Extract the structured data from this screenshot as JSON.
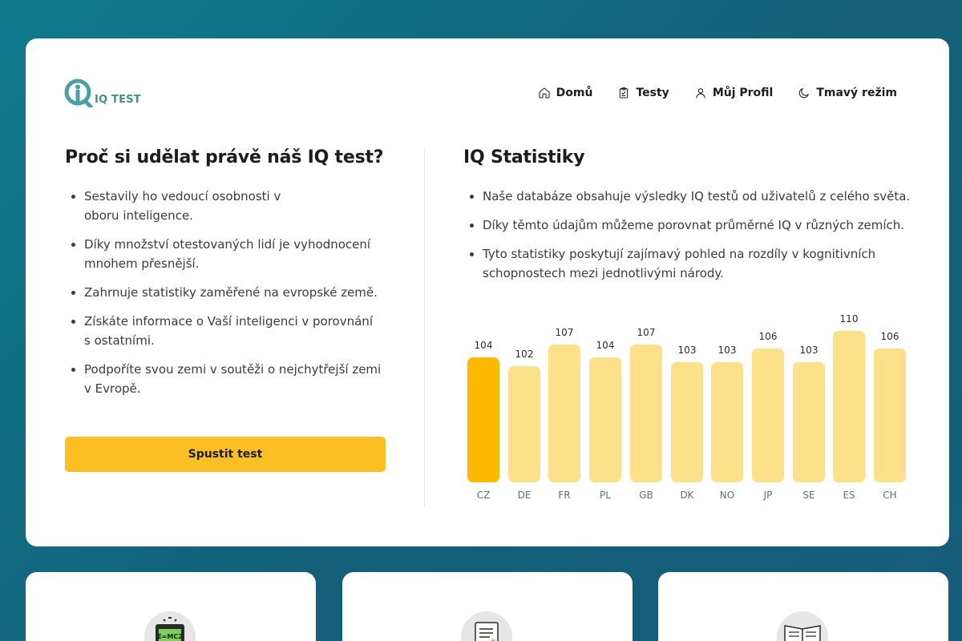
{
  "logo": {
    "text": "IQ TEST"
  },
  "nav": [
    {
      "label": "Domů",
      "icon": "home-icon"
    },
    {
      "label": "Testy",
      "icon": "clipboard-icon"
    },
    {
      "label": "Můj Profil",
      "icon": "user-icon"
    },
    {
      "label": "Tmavý režim",
      "icon": "moon-icon"
    }
  ],
  "left": {
    "title": "Proč si udělat právě náš IQ test?",
    "bullets": [
      "Sestavily ho vedoucí osobnosti v oboru inteligence.",
      "Díky množství otestovaných lidí je vyhodnocení mnohem přesnější.",
      "Zahrnuje statistiky zaměřené na evropské země.",
      "Získáte informace o Vaší inteligenci v porovnání s ostatními.",
      "Podpoříte svou zemi v soutěži o nejchytřejší zemi v Evropě."
    ],
    "button_label": "Spustit test"
  },
  "right": {
    "title": "IQ Statistiky",
    "bullets": [
      "Naše databáze obsahuje výsledky IQ testů od uživatelů z celého světa.",
      "Díky těmto údajům můžeme porovnat průměrné IQ v různých zemích.",
      "Tyto statistiky poskytují zajímavý pohled na rozdíly v kognitivních schopnostech mezi jednotlivými národy."
    ]
  },
  "chart_data": {
    "type": "bar",
    "categories": [
      "CZ",
      "DE",
      "FR",
      "PL",
      "GB",
      "DK",
      "NO",
      "JP",
      "SE",
      "ES",
      "CH"
    ],
    "values": [
      104,
      102,
      107,
      104,
      107,
      103,
      103,
      106,
      103,
      110,
      106
    ],
    "highlighted": "CZ",
    "colors": {
      "highlight": "#fbb900",
      "default": "#fde08a"
    }
  },
  "colors": {
    "accent": "#fbbf24",
    "brand": "#3d8f93",
    "background": "#136078"
  },
  "feature_cards": [
    {
      "icon": "calculator-icon"
    },
    {
      "icon": "document-icon"
    },
    {
      "icon": "book-icon"
    }
  ]
}
